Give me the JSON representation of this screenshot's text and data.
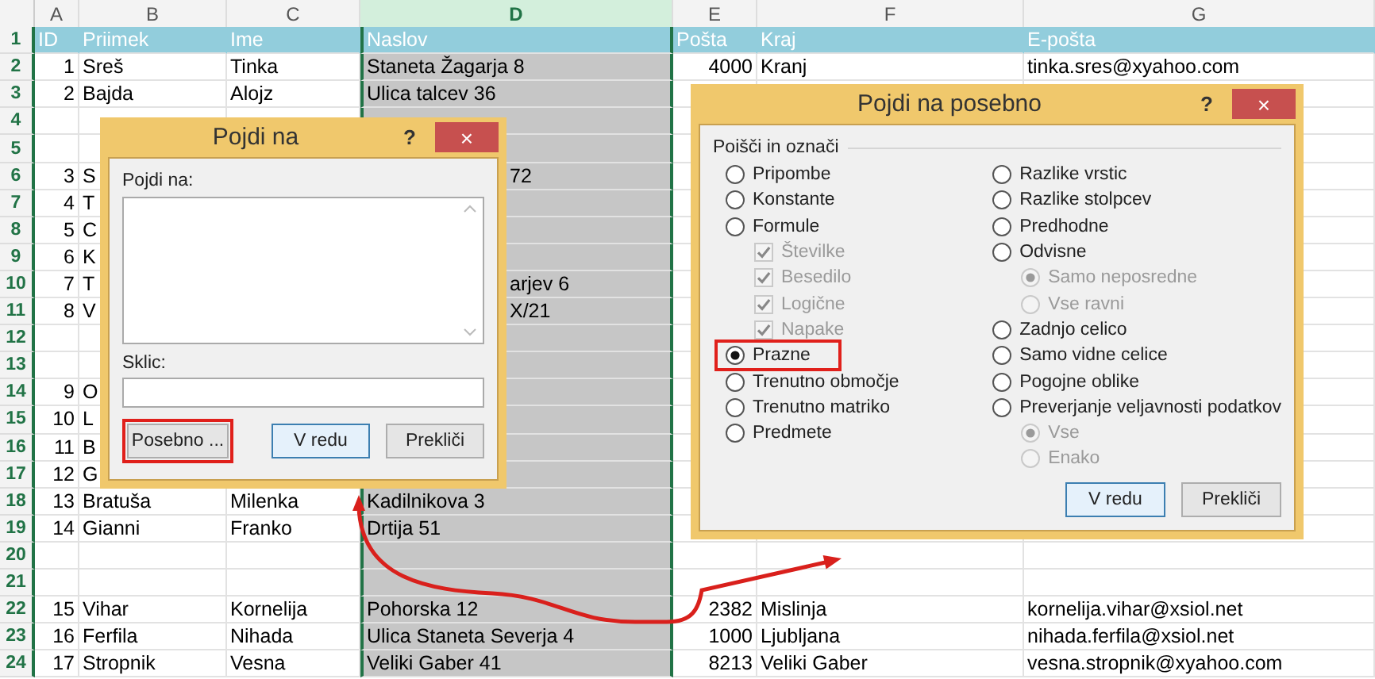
{
  "column_headers": [
    {
      "label": "A",
      "selected": false
    },
    {
      "label": "B",
      "selected": false
    },
    {
      "label": "C",
      "selected": false
    },
    {
      "label": "D",
      "selected": true
    },
    {
      "label": "E",
      "selected": false
    },
    {
      "label": "F",
      "selected": false
    },
    {
      "label": "G",
      "selected": false
    }
  ],
  "rows": [
    {
      "number": "1",
      "kind": "header",
      "id": "ID",
      "priimek": "Priimek",
      "ime": "Ime",
      "naslov": "Naslov",
      "posta": "Pošta",
      "kraj": "Kraj",
      "eposta": "E-pošta"
    },
    {
      "number": "2",
      "kind": "data",
      "id": "1",
      "priimek": "Sreš",
      "ime": "Tinka",
      "naslov": "Staneta Žagarja 8",
      "posta": "4000",
      "kraj": "Kranj",
      "eposta": "tinka.sres@xyahoo.com"
    },
    {
      "number": "3",
      "kind": "data",
      "id": "2",
      "priimek": "Bajda",
      "ime": "Alojz",
      "naslov": "Ulica talcev 36"
    },
    {
      "number": "4",
      "kind": "data"
    },
    {
      "number": "5",
      "kind": "data"
    },
    {
      "number": "6",
      "kind": "data",
      "covered": true,
      "id": "3",
      "priimek": "S",
      "naslov": "72"
    },
    {
      "number": "7",
      "kind": "data",
      "id": "4",
      "priimek": "T"
    },
    {
      "number": "8",
      "kind": "data",
      "id": "5",
      "priimek": "C"
    },
    {
      "number": "9",
      "kind": "data",
      "id": "6",
      "priimek": "K"
    },
    {
      "number": "10",
      "kind": "data",
      "covered": true,
      "id": "7",
      "priimek": "T",
      "naslov": "arjev 6"
    },
    {
      "number": "11",
      "kind": "data",
      "covered": true,
      "id": "8",
      "priimek": "V",
      "naslov": "X/21"
    },
    {
      "number": "12",
      "kind": "data"
    },
    {
      "number": "13",
      "kind": "data"
    },
    {
      "number": "14",
      "kind": "data",
      "id": "9",
      "priimek": "O"
    },
    {
      "number": "15",
      "kind": "data",
      "id": "10",
      "priimek": "L"
    },
    {
      "number": "16",
      "kind": "data",
      "id": "11",
      "priimek": "B"
    },
    {
      "number": "17",
      "kind": "data",
      "id": "12",
      "priimek": "G"
    },
    {
      "number": "18",
      "kind": "data",
      "id": "13",
      "priimek": "Bratuša",
      "ime": "Milenka",
      "naslov": "Kadilnikova 3"
    },
    {
      "number": "19",
      "kind": "data",
      "id": "14",
      "priimek": "Gianni",
      "ime": "Franko",
      "naslov": "Drtija 51"
    },
    {
      "number": "20",
      "kind": "data"
    },
    {
      "number": "21",
      "kind": "data"
    },
    {
      "number": "22",
      "kind": "data",
      "id": "15",
      "priimek": "Vihar",
      "ime": "Kornelija",
      "naslov": "Pohorska 12",
      "posta": "2382",
      "kraj": "Mislinja",
      "eposta": "kornelija.vihar@xsiol.net"
    },
    {
      "number": "23",
      "kind": "data",
      "id": "16",
      "priimek": "Ferfila",
      "ime": "Nihada",
      "naslov": "Ulica Staneta Severja 4",
      "posta": "1000",
      "kraj": "Ljubljana",
      "eposta": "nihada.ferfila@xsiol.net"
    },
    {
      "number": "24",
      "kind": "data",
      "id": "17",
      "priimek": "Stropnik",
      "ime": "Vesna",
      "naslov": "Veliki Gaber 41",
      "posta": "8213",
      "kraj": "Veliki Gaber",
      "eposta": "vesna.stropnik@xyahoo.com"
    }
  ],
  "goto_dialog": {
    "title": "Pojdi na",
    "help": "?",
    "close": "×",
    "list_label": "Pojdi na:",
    "reference_label": "Sklic:",
    "buttons": [
      {
        "label": "Posebno ...",
        "default": false,
        "highlighted": true
      },
      {
        "label": "V redu",
        "default": true,
        "highlighted": false
      },
      {
        "label": "Prekliči",
        "default": false,
        "highlighted": false
      }
    ]
  },
  "goto_special_dialog": {
    "title": "Pojdi na posebno",
    "help": "?",
    "close": "×",
    "group_label": "Poišči in označi",
    "left_options": [
      {
        "kind": "radio",
        "label": "Pripombe",
        "selected": false,
        "disabled": false,
        "highlighted": false
      },
      {
        "kind": "radio",
        "label": "Konstante",
        "selected": false,
        "disabled": false,
        "highlighted": false
      },
      {
        "kind": "radio",
        "label": "Formule",
        "selected": false,
        "disabled": false,
        "highlighted": false,
        "children": [
          {
            "kind": "checkbox",
            "label": "Številke",
            "checked": true,
            "disabled": true
          },
          {
            "kind": "checkbox",
            "label": "Besedilo",
            "checked": true,
            "disabled": true
          },
          {
            "kind": "checkbox",
            "label": "Logične",
            "checked": true,
            "disabled": true
          },
          {
            "kind": "checkbox",
            "label": "Napake",
            "checked": true,
            "disabled": true
          }
        ]
      },
      {
        "kind": "radio",
        "label": "Prazne",
        "selected": true,
        "disabled": false,
        "highlighted": true
      },
      {
        "kind": "radio",
        "label": "Trenutno območje",
        "selected": false,
        "disabled": false,
        "highlighted": false
      },
      {
        "kind": "radio",
        "label": "Trenutno matriko",
        "selected": false,
        "disabled": false,
        "highlighted": false
      },
      {
        "kind": "radio",
        "label": "Predmete",
        "selected": false,
        "disabled": false,
        "highlighted": false
      }
    ],
    "right_options": [
      {
        "kind": "radio",
        "label": "Razlike vrstic",
        "selected": false,
        "disabled": false,
        "highlighted": false
      },
      {
        "kind": "radio",
        "label": "Razlike stolpcev",
        "selected": false,
        "disabled": false,
        "highlighted": false
      },
      {
        "kind": "radio",
        "label": "Predhodne",
        "selected": false,
        "disabled": false,
        "highlighted": false
      },
      {
        "kind": "radio",
        "label": "Odvisne",
        "selected": false,
        "disabled": false,
        "highlighted": false,
        "children": [
          {
            "kind": "radio",
            "label": "Samo neposredne",
            "selected": true,
            "disabled": true
          },
          {
            "kind": "radio",
            "label": "Vse ravni",
            "selected": false,
            "disabled": true
          }
        ]
      },
      {
        "kind": "radio",
        "label": "Zadnjo celico",
        "selected": false,
        "disabled": false,
        "highlighted": false
      },
      {
        "kind": "radio",
        "label": "Samo vidne celice",
        "selected": false,
        "disabled": false,
        "highlighted": false
      },
      {
        "kind": "radio",
        "label": "Pogojne oblike",
        "selected": false,
        "disabled": false,
        "highlighted": false
      },
      {
        "kind": "radio",
        "label": "Preverjanje veljavnosti podatkov",
        "selected": false,
        "disabled": false,
        "highlighted": false,
        "children": [
          {
            "kind": "radio",
            "label": "Vse",
            "selected": true,
            "disabled": true
          },
          {
            "kind": "radio",
            "label": "Enako",
            "selected": false,
            "disabled": true
          }
        ]
      }
    ],
    "buttons": [
      {
        "label": "V redu",
        "default": true,
        "highlighted": false
      },
      {
        "label": "Prekliči",
        "default": false,
        "highlighted": false
      }
    ]
  }
}
